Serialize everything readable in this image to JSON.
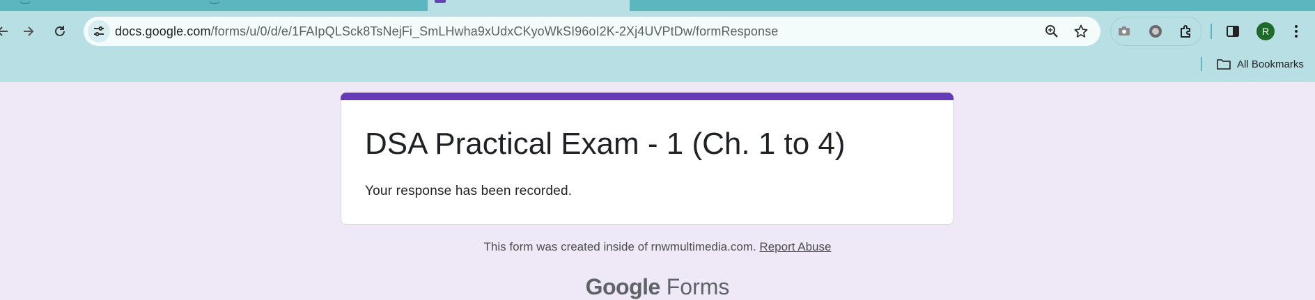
{
  "browser": {
    "url_host": "docs.google.com",
    "url_path": "/forms/u/0/d/e/1FAIpQLSck8TsNejFi_SmLHwha9xUdxCKyoWkSI96oI2K-2Xj4UVPtDw/formResponse",
    "bookmarks_label": "All Bookmarks",
    "avatar_letter": "R",
    "accent_color": "#b8e0e4",
    "tabstrip_color": "#5bb6bf"
  },
  "form": {
    "title": "DSA Practical Exam - 1 (Ch. 1 to 4)",
    "message": "Your response has been recorded.",
    "accent_color": "#673ab7",
    "background_color": "#efe9f7"
  },
  "footer": {
    "created_text": "This form was created inside of rnwmultimedia.com.",
    "report_link": "Report Abuse",
    "brand_google": "Google",
    "brand_forms": "Forms"
  }
}
